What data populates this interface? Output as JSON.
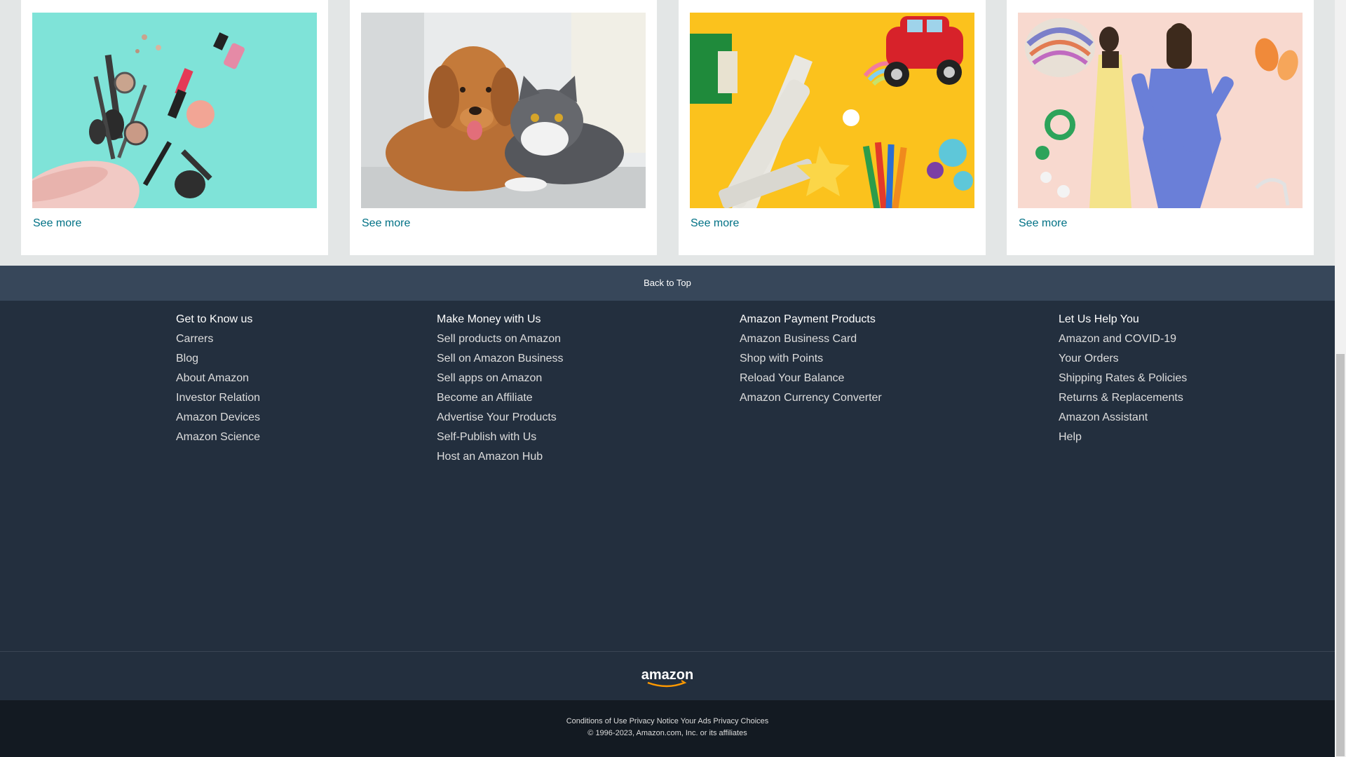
{
  "cards": [
    {
      "image": "cosmetics-makeup-bag",
      "link_label": "See more"
    },
    {
      "image": "dog-and-cat",
      "link_label": "See more"
    },
    {
      "image": "kids-toys",
      "link_label": "See more"
    },
    {
      "image": "fashion-women-clothing",
      "link_label": "See more"
    }
  ],
  "back_to_top": "Back to Top",
  "footer": {
    "columns": [
      {
        "heading": "Get to Know us",
        "links": [
          "Carrers",
          "Blog",
          "About Amazon",
          "Investor Relation",
          "Amazon Devices",
          "Amazon Science"
        ]
      },
      {
        "heading": "Make Money with Us",
        "links": [
          "Sell products on Amazon",
          "Sell on Amazon Business",
          "Sell apps on Amazon",
          "Become an Affiliate",
          "Advertise Your Products",
          "Self-Publish with Us",
          "Host an Amazon Hub"
        ]
      },
      {
        "heading": "Amazon Payment Products",
        "links": [
          "Amazon Business Card",
          "Shop with Points",
          "Reload Your Balance",
          "Amazon Currency Converter"
        ]
      },
      {
        "heading": "Let Us Help You",
        "links": [
          "Amazon and COVID-19",
          "Your Orders",
          "Shipping Rates & Policies",
          "Returns & Replacements",
          "Amazon Assistant",
          "Help"
        ]
      }
    ],
    "logo_text": "amazon",
    "legal_links": [
      "Conditions of Use",
      "Privacy Notice",
      "Your Ads Privacy Choices"
    ],
    "copyright": "© 1996-2023, Amazon.com, Inc. or its affiliates"
  },
  "colors": {
    "link": "#007185",
    "back_to_top_bg": "#37475a",
    "footer_bg": "#232f3e",
    "footer_bottom_bg": "#131a22",
    "logo_smile": "#ff9900"
  }
}
